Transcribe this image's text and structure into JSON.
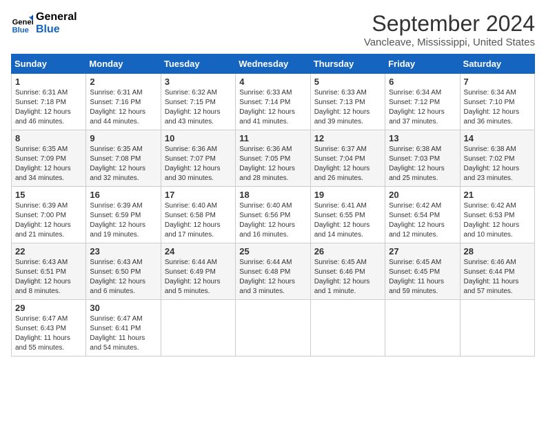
{
  "header": {
    "logo_line1": "General",
    "logo_line2": "Blue",
    "month": "September 2024",
    "location": "Vancleave, Mississippi, United States"
  },
  "days_of_week": [
    "Sunday",
    "Monday",
    "Tuesday",
    "Wednesday",
    "Thursday",
    "Friday",
    "Saturday"
  ],
  "weeks": [
    [
      {
        "day": "1",
        "info": "Sunrise: 6:31 AM\nSunset: 7:18 PM\nDaylight: 12 hours\nand 46 minutes."
      },
      {
        "day": "2",
        "info": "Sunrise: 6:31 AM\nSunset: 7:16 PM\nDaylight: 12 hours\nand 44 minutes."
      },
      {
        "day": "3",
        "info": "Sunrise: 6:32 AM\nSunset: 7:15 PM\nDaylight: 12 hours\nand 43 minutes."
      },
      {
        "day": "4",
        "info": "Sunrise: 6:33 AM\nSunset: 7:14 PM\nDaylight: 12 hours\nand 41 minutes."
      },
      {
        "day": "5",
        "info": "Sunrise: 6:33 AM\nSunset: 7:13 PM\nDaylight: 12 hours\nand 39 minutes."
      },
      {
        "day": "6",
        "info": "Sunrise: 6:34 AM\nSunset: 7:12 PM\nDaylight: 12 hours\nand 37 minutes."
      },
      {
        "day": "7",
        "info": "Sunrise: 6:34 AM\nSunset: 7:10 PM\nDaylight: 12 hours\nand 36 minutes."
      }
    ],
    [
      {
        "day": "8",
        "info": "Sunrise: 6:35 AM\nSunset: 7:09 PM\nDaylight: 12 hours\nand 34 minutes."
      },
      {
        "day": "9",
        "info": "Sunrise: 6:35 AM\nSunset: 7:08 PM\nDaylight: 12 hours\nand 32 minutes."
      },
      {
        "day": "10",
        "info": "Sunrise: 6:36 AM\nSunset: 7:07 PM\nDaylight: 12 hours\nand 30 minutes."
      },
      {
        "day": "11",
        "info": "Sunrise: 6:36 AM\nSunset: 7:05 PM\nDaylight: 12 hours\nand 28 minutes."
      },
      {
        "day": "12",
        "info": "Sunrise: 6:37 AM\nSunset: 7:04 PM\nDaylight: 12 hours\nand 26 minutes."
      },
      {
        "day": "13",
        "info": "Sunrise: 6:38 AM\nSunset: 7:03 PM\nDaylight: 12 hours\nand 25 minutes."
      },
      {
        "day": "14",
        "info": "Sunrise: 6:38 AM\nSunset: 7:02 PM\nDaylight: 12 hours\nand 23 minutes."
      }
    ],
    [
      {
        "day": "15",
        "info": "Sunrise: 6:39 AM\nSunset: 7:00 PM\nDaylight: 12 hours\nand 21 minutes."
      },
      {
        "day": "16",
        "info": "Sunrise: 6:39 AM\nSunset: 6:59 PM\nDaylight: 12 hours\nand 19 minutes."
      },
      {
        "day": "17",
        "info": "Sunrise: 6:40 AM\nSunset: 6:58 PM\nDaylight: 12 hours\nand 17 minutes."
      },
      {
        "day": "18",
        "info": "Sunrise: 6:40 AM\nSunset: 6:56 PM\nDaylight: 12 hours\nand 16 minutes."
      },
      {
        "day": "19",
        "info": "Sunrise: 6:41 AM\nSunset: 6:55 PM\nDaylight: 12 hours\nand 14 minutes."
      },
      {
        "day": "20",
        "info": "Sunrise: 6:42 AM\nSunset: 6:54 PM\nDaylight: 12 hours\nand 12 minutes."
      },
      {
        "day": "21",
        "info": "Sunrise: 6:42 AM\nSunset: 6:53 PM\nDaylight: 12 hours\nand 10 minutes."
      }
    ],
    [
      {
        "day": "22",
        "info": "Sunrise: 6:43 AM\nSunset: 6:51 PM\nDaylight: 12 hours\nand 8 minutes."
      },
      {
        "day": "23",
        "info": "Sunrise: 6:43 AM\nSunset: 6:50 PM\nDaylight: 12 hours\nand 6 minutes."
      },
      {
        "day": "24",
        "info": "Sunrise: 6:44 AM\nSunset: 6:49 PM\nDaylight: 12 hours\nand 5 minutes."
      },
      {
        "day": "25",
        "info": "Sunrise: 6:44 AM\nSunset: 6:48 PM\nDaylight: 12 hours\nand 3 minutes."
      },
      {
        "day": "26",
        "info": "Sunrise: 6:45 AM\nSunset: 6:46 PM\nDaylight: 12 hours\nand 1 minute."
      },
      {
        "day": "27",
        "info": "Sunrise: 6:45 AM\nSunset: 6:45 PM\nDaylight: 11 hours\nand 59 minutes."
      },
      {
        "day": "28",
        "info": "Sunrise: 6:46 AM\nSunset: 6:44 PM\nDaylight: 11 hours\nand 57 minutes."
      }
    ],
    [
      {
        "day": "29",
        "info": "Sunrise: 6:47 AM\nSunset: 6:43 PM\nDaylight: 11 hours\nand 55 minutes."
      },
      {
        "day": "30",
        "info": "Sunrise: 6:47 AM\nSunset: 6:41 PM\nDaylight: 11 hours\nand 54 minutes."
      },
      null,
      null,
      null,
      null,
      null
    ]
  ]
}
